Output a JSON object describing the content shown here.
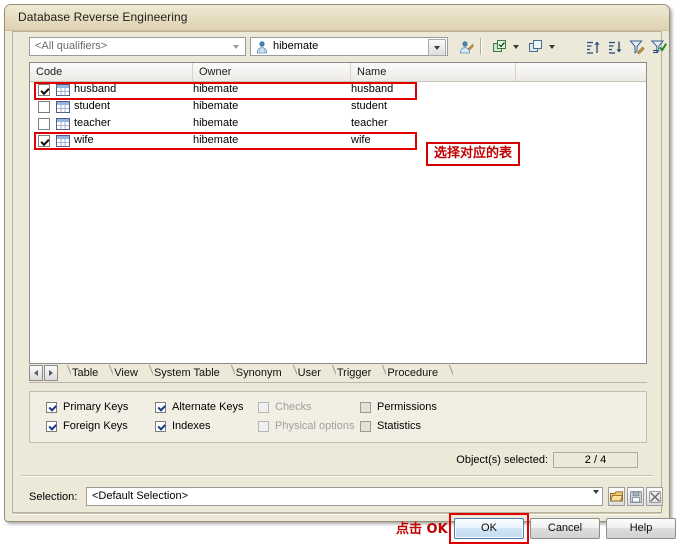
{
  "window": {
    "title": "Database Reverse Engineering"
  },
  "toolbar": {
    "qualifier": {
      "value": "<All qualifiers>",
      "name": "qualifier-combo"
    },
    "database": {
      "value": "hibemate",
      "icon": "user-icon"
    },
    "buttons": [
      {
        "name": "user-filter-button",
        "icon": "user-icon"
      },
      {
        "name": "select-all-button",
        "icon": "copy-icon"
      },
      {
        "name": "deselect-all-button",
        "icon": "copy-icon"
      },
      {
        "name": "sort-ascending-button",
        "icon": "sort-asc-icon"
      },
      {
        "name": "sort-descending-button",
        "icon": "sort-desc-icon"
      },
      {
        "name": "edit-filter-button",
        "icon": "funnel-edit-icon"
      },
      {
        "name": "apply-filter-button",
        "icon": "funnel-check-icon"
      }
    ]
  },
  "list": {
    "columns": [
      "Code",
      "Owner",
      "Name",
      ""
    ],
    "rows": [
      {
        "checked": true,
        "code": "husband",
        "owner": "hibemate",
        "name": "husband",
        "highlighted": true
      },
      {
        "checked": false,
        "code": "student",
        "owner": "hibemate",
        "name": "student",
        "highlighted": false
      },
      {
        "checked": false,
        "code": "teacher",
        "owner": "hibemate",
        "name": "teacher",
        "highlighted": false
      },
      {
        "checked": true,
        "code": "wife",
        "owner": "hibemate",
        "name": "wife",
        "highlighted": true
      }
    ]
  },
  "annotations": {
    "select_tables": "选择对应的表",
    "click_ok": "点击 OK",
    "color": "#c00000"
  },
  "tabs": {
    "selected": "Table",
    "items": [
      "Table",
      "View",
      "System Table",
      "Synonym",
      "User",
      "Trigger",
      "Procedure"
    ],
    "prev_label": "◄",
    "next_label": "►"
  },
  "options": [
    {
      "label": "Primary Keys",
      "checked": true,
      "enabled": true,
      "col": 0,
      "row": 0
    },
    {
      "label": "Foreign Keys",
      "checked": true,
      "enabled": true,
      "col": 0,
      "row": 1
    },
    {
      "label": "Alternate Keys",
      "checked": true,
      "enabled": true,
      "col": 1,
      "row": 0
    },
    {
      "label": "Indexes",
      "checked": true,
      "enabled": true,
      "col": 1,
      "row": 1
    },
    {
      "label": "Checks",
      "checked": false,
      "enabled": false,
      "col": 2,
      "row": 0
    },
    {
      "label": "Physical options",
      "checked": false,
      "enabled": false,
      "col": 2,
      "row": 1
    },
    {
      "label": "Permissions",
      "checked": false,
      "enabled": true,
      "col": 3,
      "row": 0
    },
    {
      "label": "Statistics",
      "checked": false,
      "enabled": true,
      "col": 3,
      "row": 1
    }
  ],
  "status": {
    "objects_label": "Object(s) selected:",
    "objects_value": "2 / 4"
  },
  "selection": {
    "label": "Selection:",
    "value": "<Default Selection>",
    "buttons": [
      {
        "name": "open-selection-button",
        "icon": "folder-icon"
      },
      {
        "name": "save-selection-button",
        "icon": "save-icon"
      },
      {
        "name": "delete-selection-button",
        "icon": "close-x-icon"
      }
    ]
  },
  "dialog_buttons": {
    "ok": "OK",
    "cancel": "Cancel",
    "help": "Help"
  }
}
